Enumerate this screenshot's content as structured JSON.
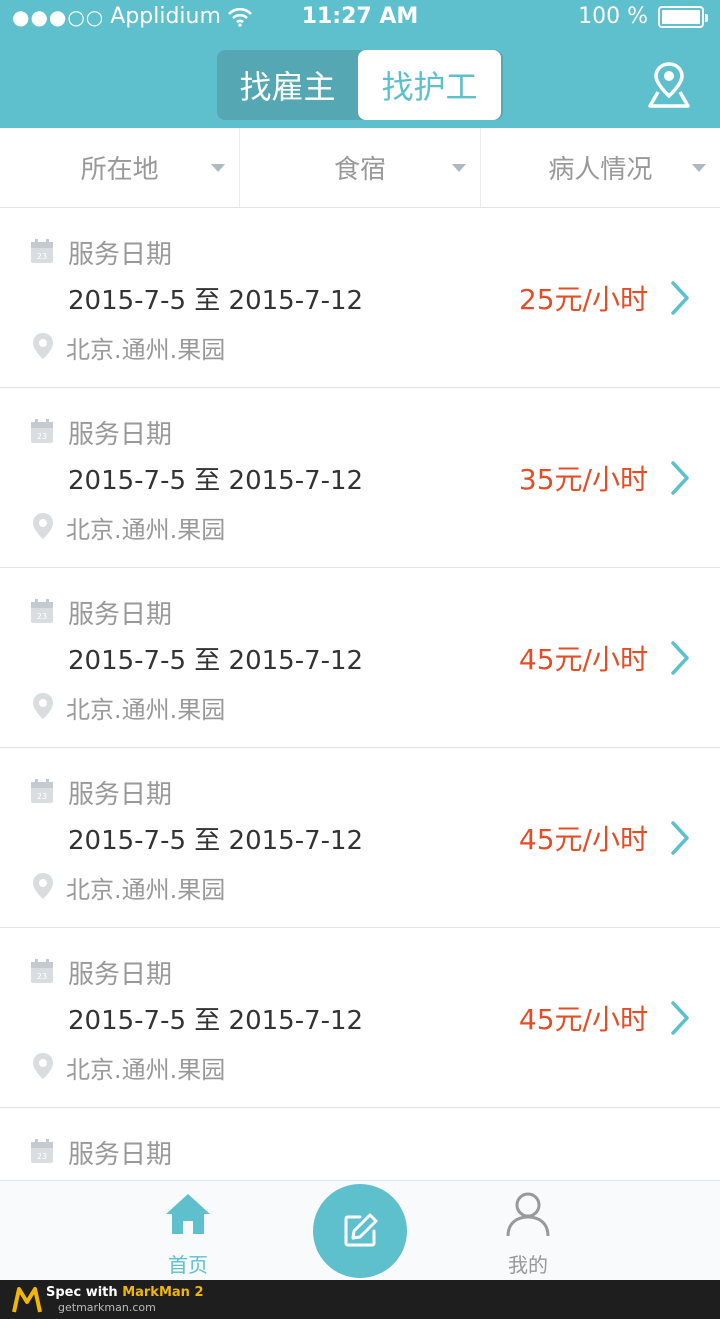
{
  "status_bar": {
    "signal_dots": "●●●○○",
    "carrier": "Applidium",
    "time": "11:27 AM",
    "battery": "100 %"
  },
  "header": {
    "segment_left": "找雇主",
    "segment_right": "找护工",
    "location_icon": "map-pin-icon"
  },
  "filters": [
    {
      "label": "所在地"
    },
    {
      "label": "食宿"
    },
    {
      "label": "病人情况"
    }
  ],
  "list": {
    "items": [
      {
        "label": "服务日期",
        "dates": "2015-7-5 至 2015-7-12",
        "address": "北京.通州.果园",
        "price": "25元/小时"
      },
      {
        "label": "服务日期",
        "dates": "2015-7-5 至 2015-7-12",
        "address": "北京.通州.果园",
        "price": "35元/小时"
      },
      {
        "label": "服务日期",
        "dates": "2015-7-5 至 2015-7-12",
        "address": "北京.通州.果园",
        "price": "45元/小时"
      },
      {
        "label": "服务日期",
        "dates": "2015-7-5 至 2015-7-12",
        "address": "北京.通州.果园",
        "price": "45元/小时"
      },
      {
        "label": "服务日期",
        "dates": "2015-7-5 至 2015-7-12",
        "address": "北京.通州.果园",
        "price": "45元/小时"
      },
      {
        "label": "服务日期"
      }
    ]
  },
  "tabbar": {
    "home": "首页",
    "compose_icon": "edit-icon",
    "mine": "我的"
  },
  "brand": {
    "line1_prefix": "Spec with ",
    "line1_name": "MarkMan 2",
    "line2": "getmarkman.com"
  },
  "colors": {
    "primary": "#5fc0cd",
    "segment_bg": "#55a8b3",
    "text_dark": "#333333",
    "text_light": "#999999",
    "arrow": "#afbac0",
    "tabbar_bg": "#f8fafb",
    "price": "#e44d26"
  }
}
